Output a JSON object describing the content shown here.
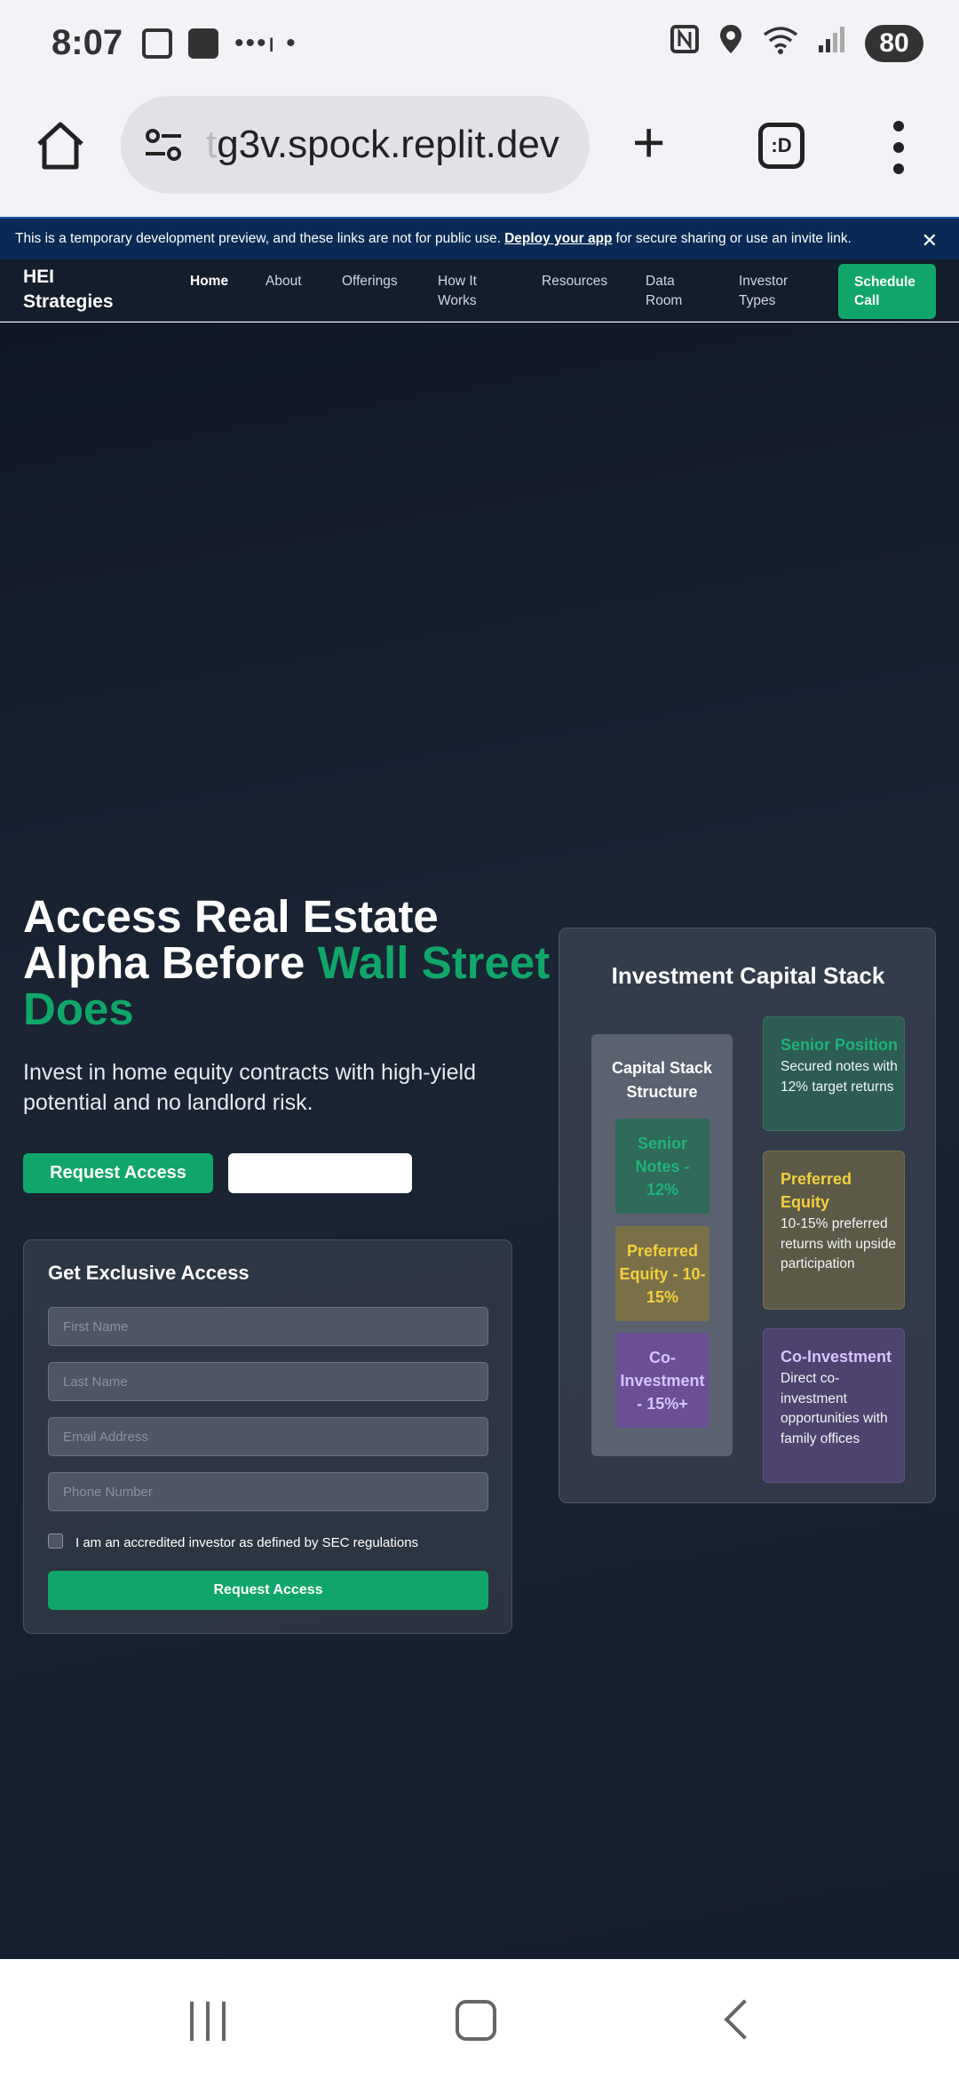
{
  "status_bar": {
    "time": "8:07",
    "dots": "•••ı •",
    "battery": "80",
    "icons": [
      "screenshot-icon",
      "clock-app-icon",
      "nfc-icon",
      "location-icon",
      "wifi-icon",
      "signal-icon"
    ]
  },
  "browser": {
    "url_faded": "t",
    "url": "g3v.spock.replit.dev",
    "tabs_label": ":D"
  },
  "banner": {
    "text_before": "This is a temporary development preview, and these links are not for public use.",
    "link": "Deploy your app",
    "text_after": "for secure sharing or use an invite link.",
    "close": "✕"
  },
  "nav": {
    "logo": "HEI Strategies",
    "items": [
      "Home",
      "About",
      "Offerings",
      "How It Works",
      "Resources",
      "Data Room",
      "Investor Types"
    ],
    "cta": "Schedule Call"
  },
  "hero": {
    "title_plain": "Access Real Estate Alpha Before",
    "title_accent": "Wall Street Does",
    "subtitle": "Invest in home equity contracts with high-yield potential and no landlord risk.",
    "primary_button": "Request Access",
    "secondary_button": ""
  },
  "form": {
    "title": "Get Exclusive Access",
    "first_name_placeholder": "First Name",
    "last_name_placeholder": "Last Name",
    "email_placeholder": "Email Address",
    "phone_placeholder": "Phone Number",
    "checkbox_label": "I am an accredited investor as defined by SEC regulations",
    "submit": "Request Access"
  },
  "capital_stack": {
    "title": "Investment Capital Stack",
    "structure_heading": "Capital Stack Structure",
    "tiers": [
      "Senior Notes - 12%",
      "Preferred Equity - 10-15%",
      "Co-Investment - 15%+"
    ],
    "details": [
      {
        "title": "Senior Position",
        "body": "Secured notes with 12% target returns"
      },
      {
        "title": "Preferred Equity",
        "body": "10-15% preferred returns with upside participation"
      },
      {
        "title": "Co-Investment",
        "body": "Direct co-investment opportunities with family offices"
      }
    ]
  },
  "colors": {
    "accent_green": "#10a66a",
    "banner_blue": "#0a2a55",
    "page_bg": "#1a2433",
    "pref_yellow": "#f2cf3d",
    "co_purple": "#d7c3ff"
  }
}
